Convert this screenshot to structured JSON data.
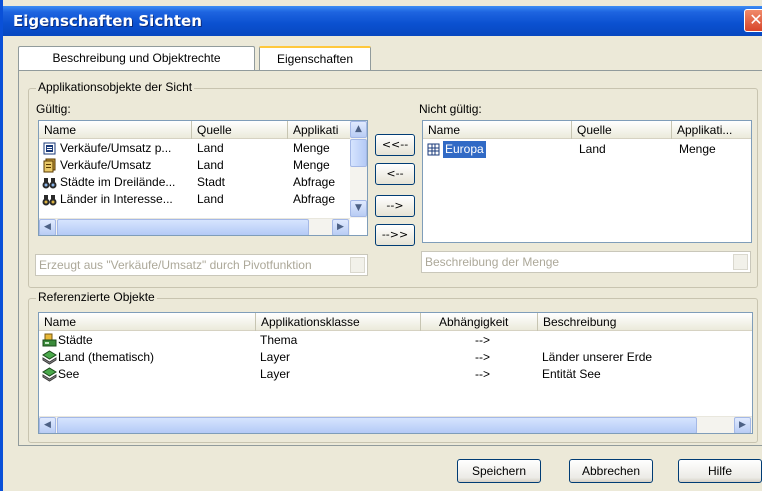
{
  "window": {
    "title": "Eigenschaften Sichten",
    "close_glyph": "✕"
  },
  "tabs": [
    {
      "label": "Beschreibung und Objektrechte"
    },
    {
      "label": "Eigenschaften"
    }
  ],
  "app_objects": {
    "group_title": "Applikationsobjekte der Sicht",
    "valid_label": "Gültig:",
    "invalid_label": "Nicht gültig:",
    "valid_columns": [
      "Name",
      "Quelle",
      "Applikati"
    ],
    "valid_rows": [
      {
        "icon": "table-icon",
        "name": "Verkäufe/Umsatz p...",
        "source": "Land",
        "app": "Menge"
      },
      {
        "icon": "query-icon",
        "name": "Verkäufe/Umsatz",
        "source": "Land",
        "app": "Menge"
      },
      {
        "icon": "binoculars-icon",
        "name": "Städte im Dreilände...",
        "source": "Stadt",
        "app": "Abfrage"
      },
      {
        "icon": "binoculars-icon",
        "name": "Länder in Interesse...",
        "source": "Land",
        "app": "Abfrage"
      }
    ],
    "invalid_columns": [
      "Name",
      "Quelle",
      "Applikati..."
    ],
    "invalid_rows": [
      {
        "icon": "grid-icon",
        "name": "Europa",
        "source": "Land",
        "app": "Menge"
      }
    ],
    "move_buttons": [
      "<<--",
      "<--",
      "-->",
      "-->>"
    ],
    "valid_description": "Erzeugt aus \"Verkäufe/Umsatz\" durch Pivotfunktion",
    "invalid_description": "Beschreibung der Menge"
  },
  "referenced": {
    "group_title": "Referenzierte Objekte",
    "columns": [
      "Name",
      "Applikationsklasse",
      "Abhängigkeit",
      "Beschreibung"
    ],
    "rows": [
      {
        "icon": "theme-icon",
        "name": "Städte",
        "class": "Thema",
        "dependency": "-->",
        "description": ""
      },
      {
        "icon": "layer-icon",
        "name": "Land (thematisch)",
        "class": "Layer",
        "dependency": "-->",
        "description": "Länder unserer Erde"
      },
      {
        "icon": "layer-icon",
        "name": "See",
        "class": "Layer",
        "dependency": "-->",
        "description": "Entität See"
      }
    ]
  },
  "buttons": {
    "save": "Speichern",
    "cancel": "Abbrechen",
    "help": "Hilfe"
  }
}
